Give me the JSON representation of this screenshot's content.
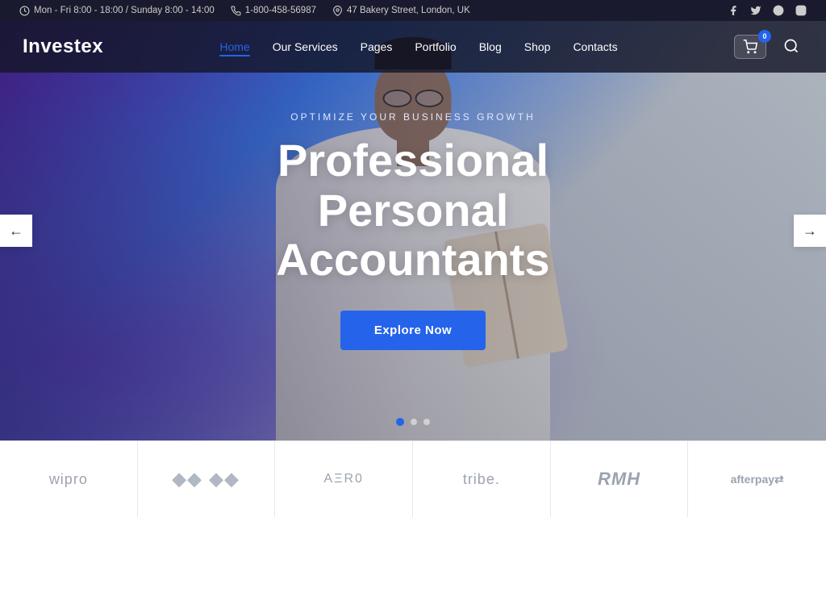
{
  "topbar": {
    "hours": "Mon - Fri 8:00 - 18:00 / Sunday 8:00 - 14:00",
    "phone": "1-800-458-56987",
    "address": "47 Bakery Street, London, UK"
  },
  "header": {
    "logo": "Investex",
    "nav": {
      "items": [
        {
          "label": "Home",
          "active": true
        },
        {
          "label": "Our Services",
          "active": false
        },
        {
          "label": "Pages",
          "active": false
        },
        {
          "label": "Portfolio",
          "active": false
        },
        {
          "label": "Blog",
          "active": false
        },
        {
          "label": "Shop",
          "active": false
        },
        {
          "label": "Contacts",
          "active": false
        }
      ]
    },
    "cart_count": "0"
  },
  "hero": {
    "subtitle": "Optimize Your Business Growth",
    "title": "Professional Personal Accountants",
    "cta_label": "Explore Now",
    "dots": [
      {
        "active": true
      },
      {
        "active": false
      },
      {
        "active": false
      }
    ]
  },
  "partners": [
    {
      "name": "wipro",
      "display": "wipro",
      "style": "wipro"
    },
    {
      "name": "diamonds",
      "display": "◆◆◆",
      "style": "diamond"
    },
    {
      "name": "aero",
      "display": "AΞRO",
      "style": "aero"
    },
    {
      "name": "tribe",
      "display": "tribe.",
      "style": "tribe"
    },
    {
      "name": "rmh",
      "display": "RMH",
      "style": "rmh"
    },
    {
      "name": "afterpay",
      "display": "afterpay⇒",
      "style": "afterpay"
    }
  ]
}
